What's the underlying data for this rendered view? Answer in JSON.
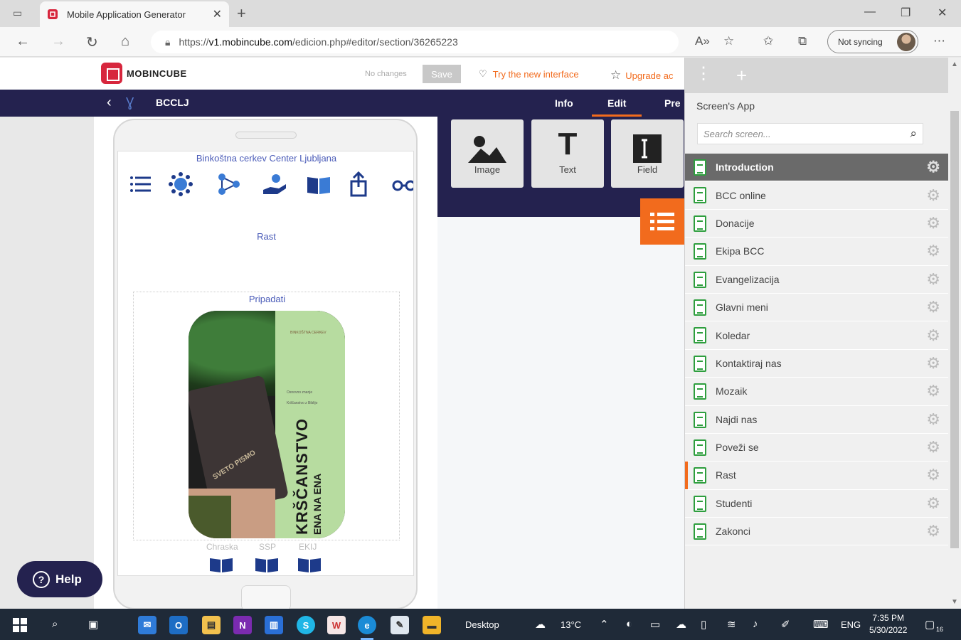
{
  "browser": {
    "tab_title": "Mobile Application Generator",
    "url_prefix": "https://",
    "url_domain": "v1.mobincube.com",
    "url_path": "/edicion.php#editor/section/36265223",
    "sync_label": "Not syncing"
  },
  "header": {
    "brand": "MOBINCUBE",
    "status": "No changes",
    "save_label": "Save",
    "try_new": "Try the new interface",
    "upgrade": "Upgrade ac"
  },
  "appnav": {
    "app_name": "BCCLJ",
    "tabs": [
      "Info",
      "Edit",
      "Pre"
    ]
  },
  "phone": {
    "church_name": "Binkoštna cerkev Center Ljubljana",
    "rast_label": "Rast",
    "pripadati_label": "Pripadati",
    "poster": {
      "brand_small": "BINKOŠTNA CERKEV",
      "subtitle_1": "Osnovno znanje",
      "subtitle_2": "Krščanstvo z Biblijo",
      "bible_text": "SVETO PISMO",
      "headline": "KRŠČANSTVO",
      "subline": "ENA NA ENA"
    },
    "bottom_labels": [
      "Chraska",
      "SSP",
      "EKIJ"
    ]
  },
  "components": [
    {
      "label": "Image",
      "icon": "image-icon"
    },
    {
      "label": "Text",
      "icon": "text-icon"
    },
    {
      "label": "Field",
      "icon": "field-icon"
    }
  ],
  "screens_panel": {
    "title": "Screen's App",
    "search_placeholder": "Search screen...",
    "items": [
      {
        "label": "Introduction",
        "active": true
      },
      {
        "label": "BCC online"
      },
      {
        "label": "Donacije"
      },
      {
        "label": "Ekipa BCC"
      },
      {
        "label": "Evangelizacija"
      },
      {
        "label": "Glavni meni"
      },
      {
        "label": "Koledar"
      },
      {
        "label": "Kontaktiraj nas"
      },
      {
        "label": "Mozaik"
      },
      {
        "label": "Najdi nas"
      },
      {
        "label": "Poveži se"
      },
      {
        "label": "Rast",
        "current": true
      },
      {
        "label": "Studenti"
      },
      {
        "label": "Zakonci"
      }
    ]
  },
  "help_label": "Help",
  "taskbar": {
    "desktop_label": "Desktop",
    "weather": "13°C",
    "lang": "ENG",
    "time": "7:35 PM",
    "date": "5/30/2022",
    "notif_count": "16"
  },
  "colors": {
    "accent": "#f26b1d",
    "nav_dark": "#24224f",
    "link_blue": "#4a5bb8",
    "screen_icon_green": "#2e9e3e"
  }
}
